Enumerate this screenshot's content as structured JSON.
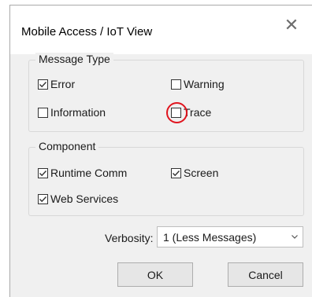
{
  "dialog": {
    "title": "Mobile Access / IoT View",
    "close_glyph": "✕"
  },
  "message_type": {
    "legend": "Message Type",
    "items": [
      {
        "label": "Error",
        "checked": true
      },
      {
        "label": "Warning",
        "checked": false
      },
      {
        "label": "Information",
        "checked": false
      },
      {
        "label": "Trace",
        "checked": false,
        "highlighted": true
      }
    ]
  },
  "component": {
    "legend": "Component",
    "items": [
      {
        "label": "Runtime Comm",
        "checked": true
      },
      {
        "label": "Screen",
        "checked": true
      },
      {
        "label": "Web Services",
        "checked": true
      }
    ]
  },
  "verbosity": {
    "label": "Verbosity:",
    "value": "1 (Less Messages)"
  },
  "buttons": {
    "ok": "OK",
    "cancel": "Cancel"
  },
  "colors": {
    "highlight_ring": "#e0141e",
    "dialog_bg": "#f0f0f0"
  }
}
